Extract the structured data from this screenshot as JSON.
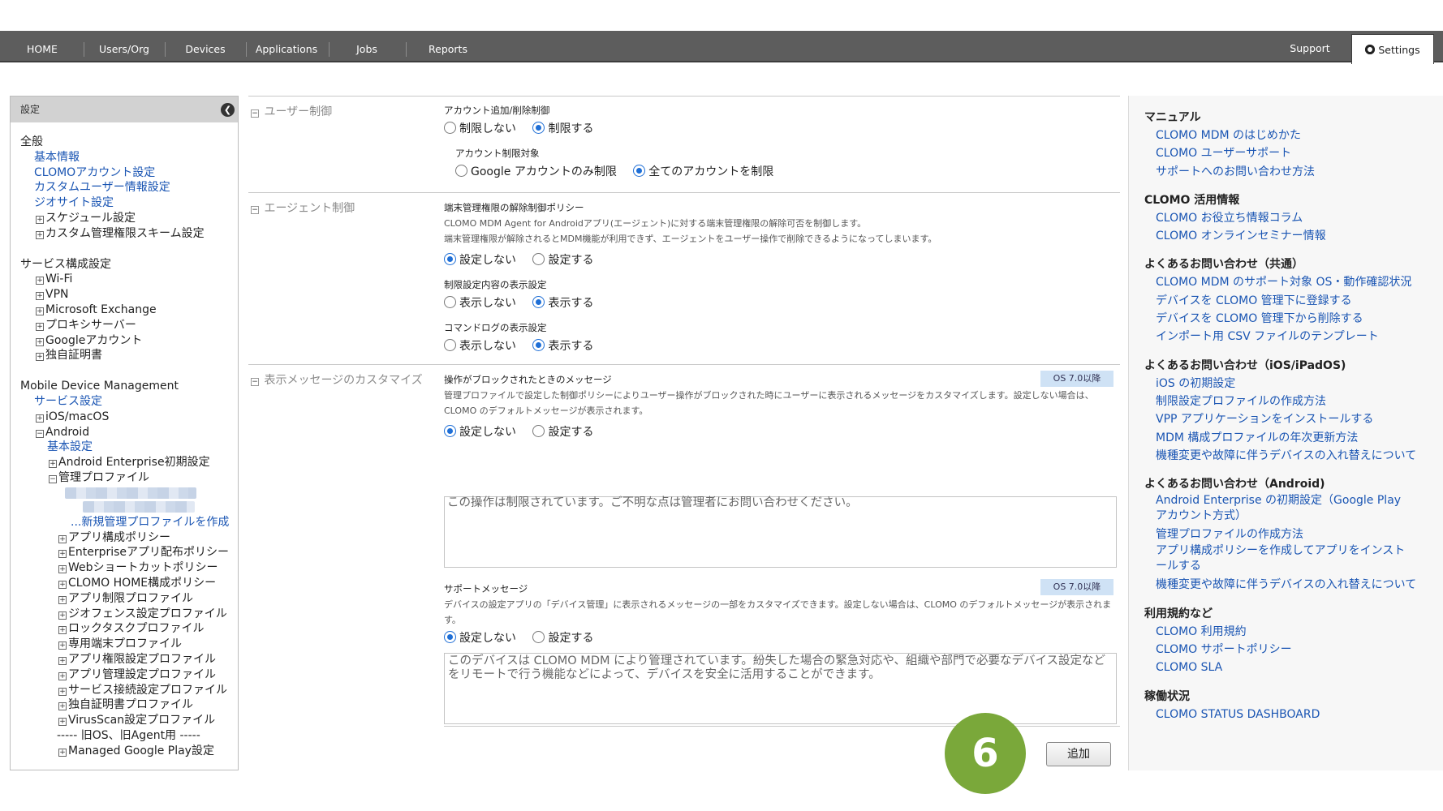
{
  "nav": {
    "items": [
      "HOME",
      "Users/Org",
      "Devices",
      "Applications",
      "Jobs",
      "Reports"
    ],
    "support": "Support",
    "settings": "Settings"
  },
  "sidebar": {
    "title": "設定",
    "general": {
      "heading": "全般",
      "links": [
        "基本情報",
        "CLOMOアカウント設定",
        "カスタムユーザー情報設定",
        "ジオサイト設定"
      ],
      "items": [
        "スケジュール設定",
        "カスタム管理権限スキーム設定"
      ]
    },
    "service": {
      "heading": "サービス構成設定",
      "items": [
        "Wi-Fi",
        "VPN",
        "Microsoft Exchange",
        "プロキシサーバー",
        "Googleアカウント",
        "独自証明書"
      ]
    },
    "mdm": {
      "heading": "Mobile Device Management",
      "service_link": "サービス設定",
      "ios": "iOS/macOS",
      "android": "Android",
      "basic_link": "基本設定",
      "ae_init": "Android Enterprise初期設定",
      "managed_profile": "管理プロファイル",
      "new_profile_link": "...新規管理プロファイルを作成",
      "policies": [
        "アプリ構成ポリシー",
        "Enterpriseアプリ配布ポリシー",
        "Webショートカットポリシー",
        "CLOMO HOME構成ポリシー",
        "アプリ制限プロファイル",
        "ジオフェンス設定プロファイル",
        "ロックタスクプロファイル",
        "専用端末プロファイル",
        "アプリ権限設定プロファイル",
        "アプリ管理設定プロファイル",
        "サービス接続設定プロファイル",
        "独自証明書プロファイル",
        "VirusScan設定プロファイル"
      ],
      "legacy_divider": "----- 旧OS、旧Agent用 -----",
      "managed_play": "Managed Google Play設定"
    }
  },
  "main": {
    "user_control": {
      "title": "ユーザー制御",
      "account_label": "アカウント追加/削除制御",
      "account_opts": [
        "制限しない",
        "制限する"
      ],
      "target_label": "アカウント制限対象",
      "target_opts": [
        "Google アカウントのみ制限",
        "全てのアカウントを制限"
      ]
    },
    "agent_control": {
      "title": "エージェント制御",
      "release_label": "端末管理権限の解除制御ポリシー",
      "release_desc1": "CLOMO MDM Agent for Androidアプリ(エージェント)に対する端末管理権限の解除可否を制御します。",
      "release_desc2": "端末管理権限が解除されるとMDM機能が利用できず、エージェントをユーザー操作で削除できるようになってしまいます。",
      "release_opts": [
        "設定しない",
        "設定する"
      ],
      "display_label": "制限設定内容の表示設定",
      "display_opts": [
        "表示しない",
        "表示する"
      ],
      "cmdlog_label": "コマンドログの表示設定",
      "cmdlog_opts": [
        "表示しない",
        "表示する"
      ]
    },
    "message": {
      "title": "表示メッセージのカスタマイズ",
      "block_label": "操作がブロックされたときのメッセージ",
      "block_badge": "OS 7.0以降",
      "block_desc": "管理プロファイルで設定した制御ポリシーによりユーザー操作がブロックされた時にユーザーに表示されるメッセージをカスタマイズします。設定しない場合は、CLOMO のデフォルトメッセージが表示されます。",
      "block_opts": [
        "設定しない",
        "設定する"
      ],
      "block_text": "この操作は制限されています。ご不明な点は管理者にお問い合わせください。",
      "support_label": "サポートメッセージ",
      "support_badge": "OS 7.0以降",
      "support_desc": "デバイスの設定アプリの「デバイス管理」に表示されるメッセージの一部をカスタマイズできます。設定しない場合は、CLOMO のデフォルトメッセージが表示されます。",
      "support_opts": [
        "設定しない",
        "設定する"
      ],
      "support_text": "このデバイスは CLOMO MDM により管理されています。紛失した場合の緊急対応や、組織や部門で必要なデバイス設定などをリモートで行う機能などによって、デバイスを安全に活用することができます。"
    },
    "add_button": "追加",
    "step_number": "6"
  },
  "right": {
    "sections": [
      {
        "heading": "マニュアル",
        "links": [
          "CLOMO MDM のはじめかた",
          "CLOMO ユーザーサポート",
          "サポートへのお問い合わせ方法"
        ]
      },
      {
        "heading": "CLOMO 活用情報",
        "links": [
          "CLOMO お役立ち情報コラム",
          "CLOMO オンラインセミナー情報"
        ]
      },
      {
        "heading": "よくあるお問い合わせ（共通）",
        "links": [
          "CLOMO MDM のサポート対象 OS・動作確認状況",
          "デバイスを CLOMO 管理下に登録する",
          "デバイスを CLOMO 管理下から削除する",
          "インポート用 CSV ファイルのテンプレート"
        ]
      },
      {
        "heading": "よくあるお問い合わせ（iOS/iPadOS)",
        "links": [
          "iOS の初期設定",
          "制限設定プロファイルの作成方法",
          "VPP アプリケーションをインストールする",
          "MDM 構成プロファイルの年次更新方法",
          "機種変更や故障に伴うデバイスの入れ替えについて"
        ]
      },
      {
        "heading": "よくあるお問い合わせ（Android)",
        "links": [
          "Android Enterprise の初期設定（Google Play アカウント方式）",
          "管理プロファイルの作成方法",
          "アプリ構成ポリシーを作成してアプリをインストールする",
          "機種変更や故障に伴うデバイスの入れ替えについて"
        ]
      },
      {
        "heading": "利用規約など",
        "links": [
          "CLOMO 利用規約",
          "CLOMO サポートポリシー",
          "CLOMO SLA"
        ]
      },
      {
        "heading": "稼働状況",
        "links": [
          "CLOMO STATUS DASHBOARD"
        ]
      }
    ]
  },
  "colors": {
    "accent_blue": "#1f6fd6",
    "link_blue": "#1a55b3",
    "nav_bg": "#5d5d5d",
    "step_green": "#7aa83a"
  }
}
